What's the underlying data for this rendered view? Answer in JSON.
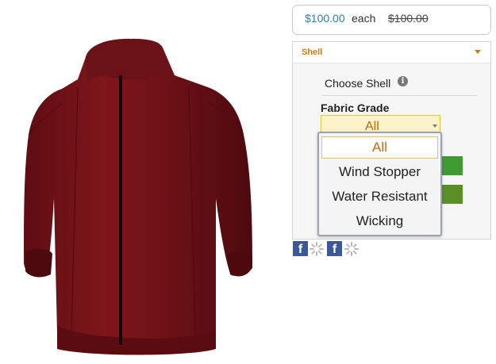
{
  "product": {
    "image_alt": "maroon hooded jacket"
  },
  "price": {
    "current": "$100.00",
    "unit": "each",
    "original": "$100.00"
  },
  "shell_section": {
    "title": "Shell",
    "choose_label": "Choose Shell",
    "fabric_grade_label": "Fabric Grade",
    "fabric_grade_selected": "All"
  },
  "fabric_grade_dropdown": {
    "options": [
      "All",
      "Wind Stopper",
      "Water Resistant",
      "Wicking"
    ],
    "selected_index": 0
  },
  "swatch_colors": [
    "#3f9a32",
    "#5a8f25"
  ],
  "social": {
    "facebook_icon_letter": "f"
  }
}
